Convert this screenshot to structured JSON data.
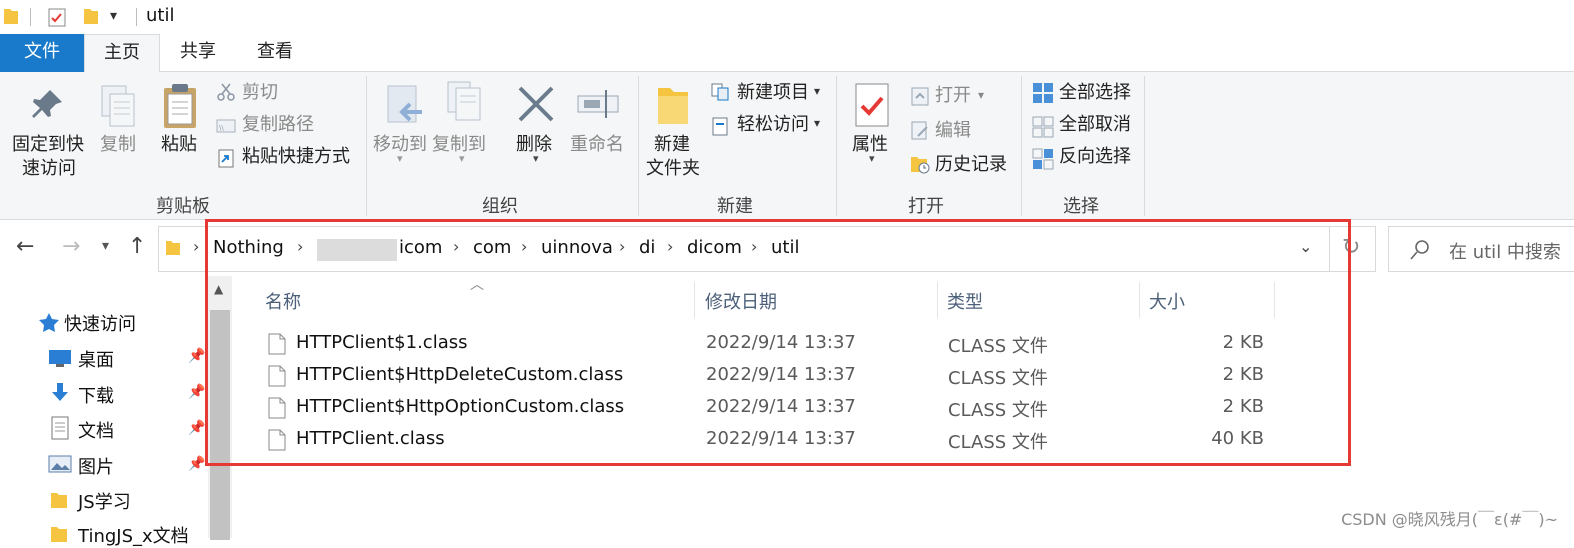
{
  "window": {
    "title": "util"
  },
  "tabs": {
    "file": "文件",
    "home": "主页",
    "share": "共享",
    "view": "查看"
  },
  "ribbon": {
    "clipboard": {
      "pin_label_1": "固定到快",
      "pin_label_2": "速访问",
      "copy": "复制",
      "paste": "粘贴",
      "cut": "剪切",
      "copy_path": "复制路径",
      "paste_shortcut": "粘贴快捷方式",
      "group": "剪贴板"
    },
    "organize": {
      "move_to": "移动到",
      "copy_to": "复制到",
      "delete": "删除",
      "rename": "重命名",
      "group": "组织"
    },
    "new": {
      "new_folder_1": "新建",
      "new_folder_2": "文件夹",
      "new_item": "新建项目",
      "easy_access": "轻松访问",
      "group": "新建"
    },
    "open": {
      "properties": "属性",
      "open": "打开",
      "edit": "编辑",
      "history": "历史记录",
      "group": "打开"
    },
    "select": {
      "select_all": "全部选择",
      "select_none": "全部取消",
      "invert": "反向选择",
      "group": "选择"
    }
  },
  "address": {
    "crumbs": [
      "Nothing",
      "icom",
      "com",
      "uinnova",
      "di",
      "dicom",
      "util"
    ],
    "search_placeholder": "在 util 中搜索"
  },
  "sidebar": {
    "items": [
      {
        "label": "快速访问",
        "icon": "star-icon"
      },
      {
        "label": "桌面",
        "icon": "desktop-icon"
      },
      {
        "label": "下载",
        "icon": "download-icon"
      },
      {
        "label": "文档",
        "icon": "document-icon"
      },
      {
        "label": "图片",
        "icon": "picture-icon"
      },
      {
        "label": "JS学习",
        "icon": "folder-icon"
      },
      {
        "label": "TingJS_x文档",
        "icon": "folder-icon"
      }
    ]
  },
  "list": {
    "columns": {
      "name": "名称",
      "date": "修改日期",
      "type": "类型",
      "size": "大小"
    },
    "rows": [
      {
        "name": "HTTPClient$1.class",
        "date": "2022/9/14 13:37",
        "type": "CLASS 文件",
        "size": "2 KB"
      },
      {
        "name": "HTTPClient$HttpDeleteCustom.class",
        "date": "2022/9/14 13:37",
        "type": "CLASS 文件",
        "size": "2 KB"
      },
      {
        "name": "HTTPClient$HttpOptionCustom.class",
        "date": "2022/9/14 13:37",
        "type": "CLASS 文件",
        "size": "2 KB"
      },
      {
        "name": "HTTPClient.class",
        "date": "2022/9/14 13:37",
        "type": "CLASS 文件",
        "size": "40 KB"
      }
    ]
  },
  "watermark": "CSDN @晓风残月(￣ε(#￣)~",
  "colors": {
    "accent": "#1979ca",
    "highlight": "#e53935",
    "folder": "#f5c542"
  }
}
